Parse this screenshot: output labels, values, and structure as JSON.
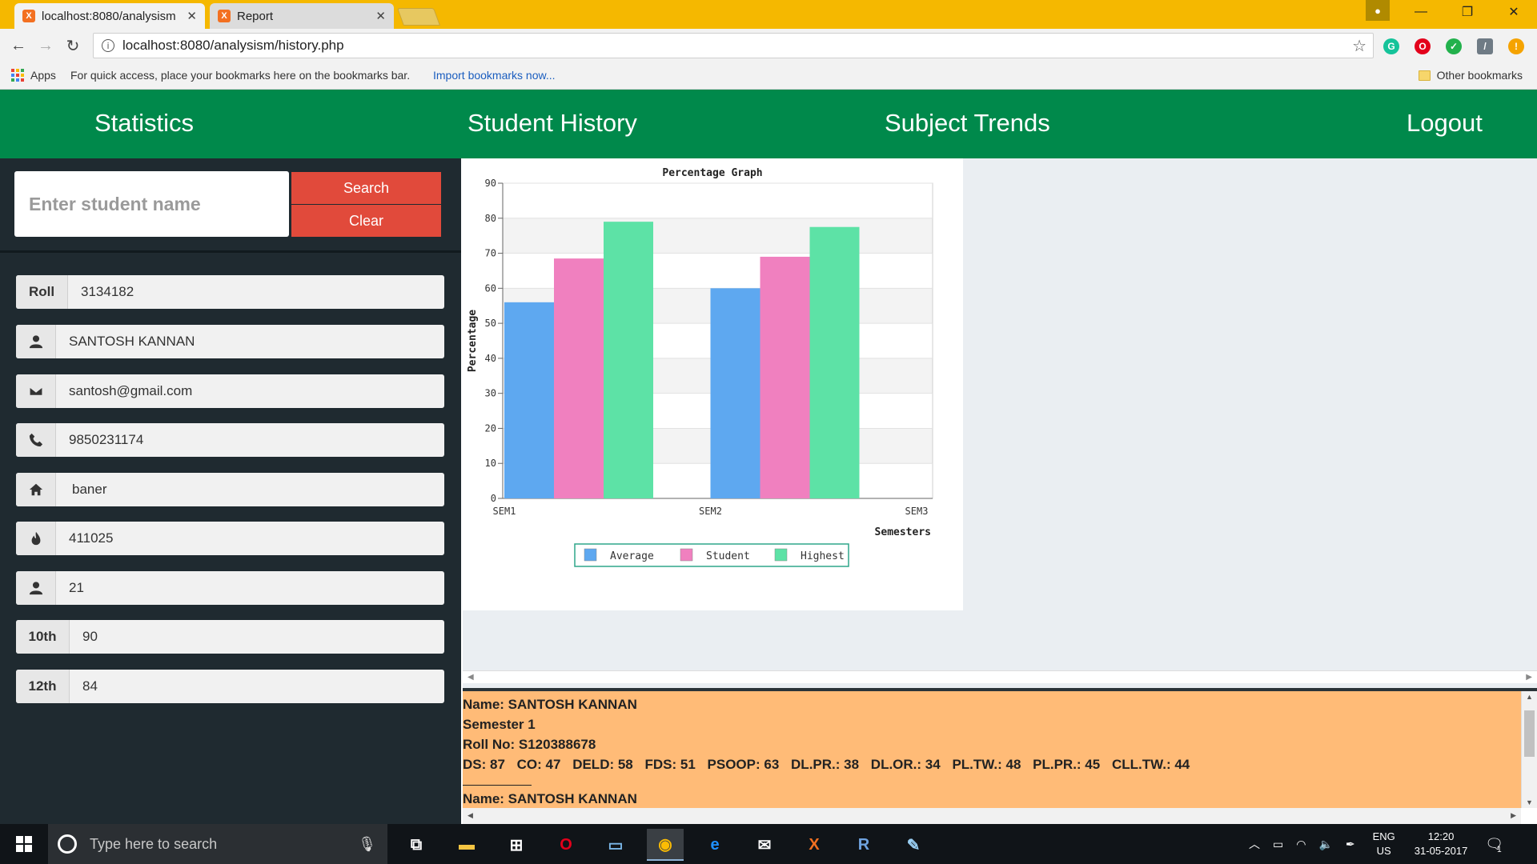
{
  "browser": {
    "tabs": [
      {
        "title": "localhost:8080/analysism",
        "active": true
      },
      {
        "title": "Report",
        "active": false
      }
    ],
    "url": "localhost:8080/analysism/history.php",
    "bookmarks_bar": {
      "apps_label": "Apps",
      "hint": "For quick access, place your bookmarks here on the bookmarks bar.",
      "import_link": "Import bookmarks now...",
      "other_bookmarks": "Other bookmarks"
    }
  },
  "nav": {
    "statistics": "Statistics",
    "student_history": "Student History",
    "subject_trends": "Subject Trends",
    "logout": "Logout"
  },
  "search": {
    "placeholder": "Enter student name",
    "search_button": "Search",
    "clear_button": "Clear"
  },
  "student": {
    "roll_label": "Roll",
    "roll": "3134182",
    "name": "SANTOSH KANNAN",
    "email": "santosh@gmail.com",
    "phone": "9850231174",
    "address": "baner",
    "pincode": "411025",
    "age": "21",
    "tenth_label": "10th",
    "tenth": "90",
    "twelfth_label": "12th",
    "twelfth": "84"
  },
  "chart_data": {
    "type": "bar",
    "title": "Percentage Graph",
    "xlabel": "Semesters",
    "ylabel": "Percentage",
    "categories": [
      "SEM1",
      "SEM2",
      "SEM3"
    ],
    "ylim": [
      0,
      90
    ],
    "yticks": [
      0,
      10,
      20,
      30,
      40,
      50,
      60,
      70,
      80,
      90
    ],
    "series": [
      {
        "name": "Average",
        "color": "#5ea8f0",
        "values": [
          56,
          60,
          null
        ]
      },
      {
        "name": "Student",
        "color": "#f080bf",
        "values": [
          68.5,
          69,
          null
        ]
      },
      {
        "name": "Highest",
        "color": "#5de2a6",
        "values": [
          79,
          77.5,
          null
        ]
      }
    ],
    "legend": "bottom"
  },
  "report": {
    "name_line": "Name: SANTOSH KANNAN",
    "semester_line": "Semester 1",
    "roll_line": "Roll No: S120388678",
    "marks": [
      "DS: 87",
      "CO: 47",
      "DELD: 58",
      "FDS: 51",
      "PSOOP: 63",
      "DL.PR.: 38",
      "DL.OR.: 34",
      "PL.TW.: 48",
      "PL.PR.: 45",
      "CLL.TW.: 44"
    ],
    "next_name_line": "Name: SANTOSH KANNAN"
  },
  "taskbar": {
    "search_placeholder": "Type here to search",
    "lang_top": "ENG",
    "lang_bottom": "US",
    "time": "12:20",
    "date": "31-05-2017",
    "notification_count": "1"
  }
}
